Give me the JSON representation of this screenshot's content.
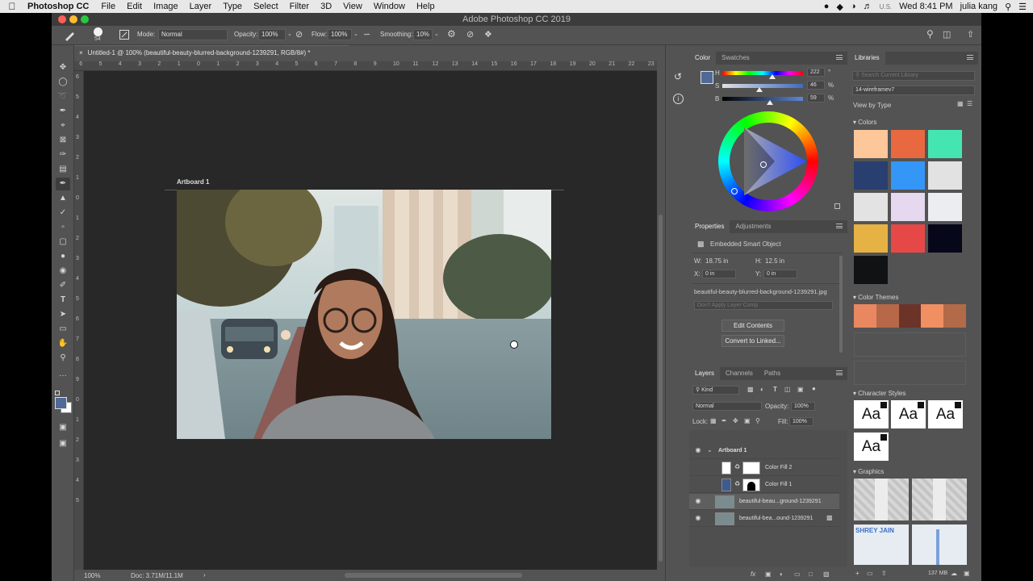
{
  "menubar": {
    "app": "Photoshop CC",
    "items": [
      "File",
      "Edit",
      "Image",
      "Layer",
      "Type",
      "Select",
      "Filter",
      "3D",
      "View",
      "Window",
      "Help"
    ],
    "input_source": "U.S.",
    "clock": "Wed 8:41 PM",
    "user": "julia kang"
  },
  "window": {
    "title": "Adobe Photoshop CC 2019"
  },
  "options": {
    "brush_size": "54",
    "mode_label": "Mode:",
    "mode_value": "Normal",
    "opacity_label": "Opacity:",
    "opacity_value": "100%",
    "flow_label": "Flow:",
    "flow_value": "100%",
    "smoothing_label": "Smoothing:",
    "smoothing_value": "10%"
  },
  "document": {
    "tab": "Untitled-1 @ 100% (beautiful-beauty-blurred-background-1239291, RGB/8#) *",
    "artboard_label": "Artboard 1",
    "ruler_top": [
      "0",
      "1",
      "2",
      "3",
      "4",
      "5",
      "6",
      "7",
      "8",
      "9",
      "10",
      "11",
      "12",
      "13",
      "14",
      "15",
      "16",
      "17",
      "18",
      "19",
      "20",
      "21",
      "22",
      "23"
    ],
    "ruler_top_neg": [
      "6",
      "5",
      "4",
      "3",
      "2",
      "1"
    ],
    "ruler_left": [
      "6",
      "5",
      "4",
      "3",
      "2",
      "1",
      "0",
      "1",
      "2",
      "3",
      "4",
      "5",
      "6",
      "7",
      "8",
      "9",
      "0",
      "1",
      "2",
      "3",
      "4",
      "5"
    ],
    "zoom": "100%",
    "doc_size": "Doc: 3.71M/11.1M"
  },
  "color_panel": {
    "tabs": [
      "Color",
      "Swatches"
    ],
    "h_label": "H",
    "h_value": "222",
    "h_unit": "°",
    "h_level": 0.62,
    "s_label": "S",
    "s_value": "46",
    "s_unit": "%",
    "s_level": 0.46,
    "b_label": "B",
    "b_value": "59",
    "b_unit": "%",
    "b_level": 0.59,
    "foreground": "#4f6a96"
  },
  "properties_panel": {
    "tabs": [
      "Properties",
      "Adjustments"
    ],
    "kind": "Embedded Smart Object",
    "w_label": "W:",
    "w_value": "18.75 in",
    "h_label": "H:",
    "h_value": "12.5 in",
    "x_label": "X:",
    "x_value": "0 in",
    "y_label": "Y:",
    "y_value": "0 in",
    "filename": "beautiful-beauty-blurred-background-1239291.jpg",
    "layer_comp_placeholder": "Don't Apply Layer Comp",
    "edit_contents": "Edit Contents",
    "convert_linked": "Convert to Linked..."
  },
  "layers_panel": {
    "tabs": [
      "Layers",
      "Channels",
      "Paths"
    ],
    "filter_value": "Kind",
    "blend_value": "Normal",
    "opacity_label": "Opacity:",
    "opacity_value": "100%",
    "lock_label": "Lock:",
    "fill_label": "Fill:",
    "fill_value": "100%",
    "layers": [
      {
        "name": "Artboard 1",
        "visible": true
      },
      {
        "name": "Color Fill 2",
        "visible": false
      },
      {
        "name": "Color Fill 1",
        "visible": false
      },
      {
        "name": "beautiful-beau...ground-1239291",
        "visible": true
      },
      {
        "name": "beautiful-bea...ound-1239291",
        "visible": true
      }
    ],
    "footer_fx": "fx"
  },
  "libraries_panel": {
    "tab": "Libraries",
    "search_placeholder": "Search Current Library",
    "library": "14-wireframev7",
    "view_by": "View by Type",
    "colors_header": "Colors",
    "colors": [
      "#fdc79a",
      "#e8693f",
      "#45e5b1",
      "#283f6f",
      "#3496f7",
      "#e2e2e2",
      "#e3e3e3",
      "#e6d8ef",
      "#ecedf0",
      "#e5b243",
      "#e64848",
      "#07071a",
      "#111214"
    ],
    "themes_header": "Color Themes",
    "theme": [
      "#e98860",
      "#b66848",
      "#6c3329",
      "#ef8f62",
      "#b36a49"
    ],
    "char_header": "Character Styles",
    "char_sample": "Aa",
    "graphics_header": "Graphics",
    "graphic_text": "SHREY JAIN",
    "storage": "137 MB"
  }
}
